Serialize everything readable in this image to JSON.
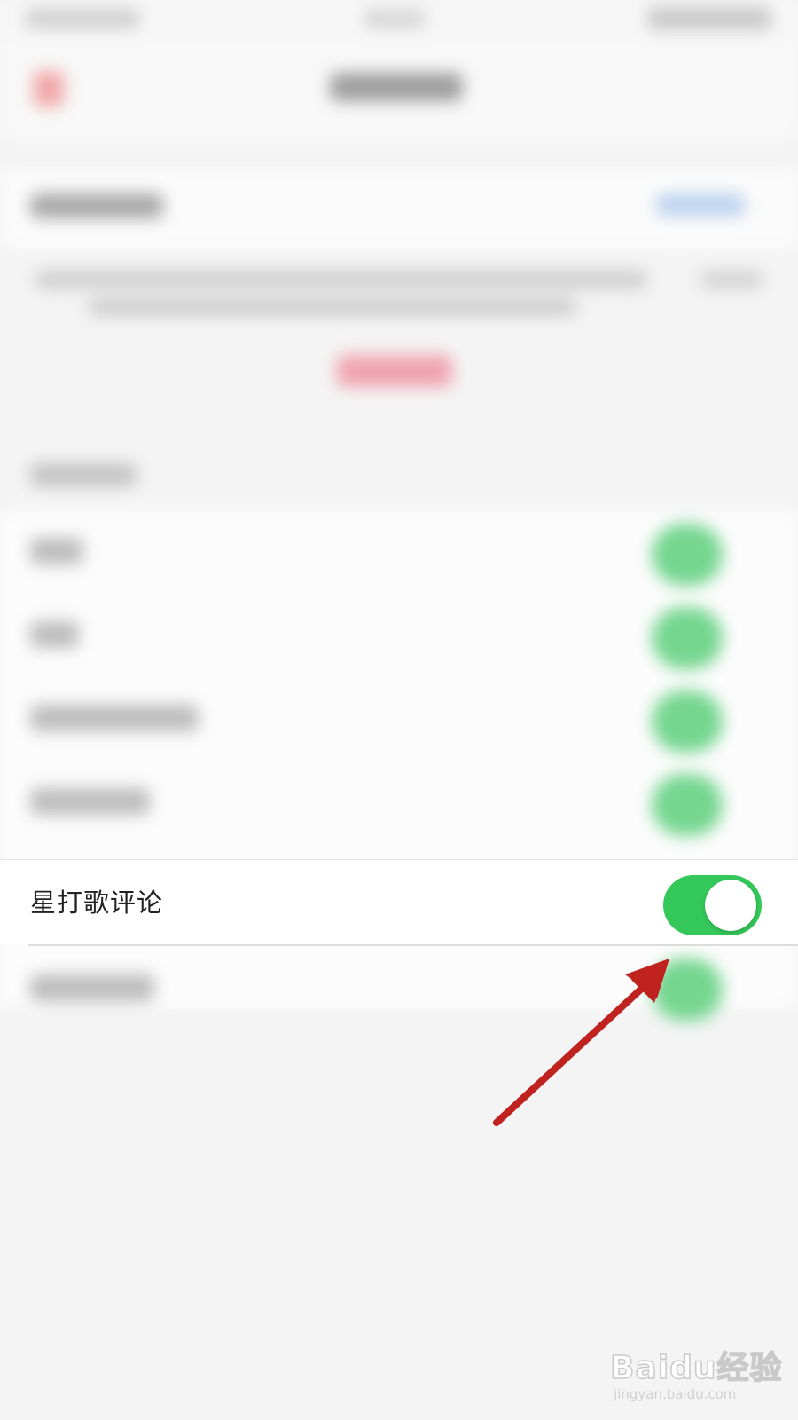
{
  "setting": {
    "label": "星打歌评论",
    "toggle_on": true,
    "toggle_color": "#34c759"
  },
  "annotation": {
    "color": "#c0221f",
    "icon": "arrow-icon"
  },
  "watermark": {
    "logo": "Baidu经验",
    "url": "jingyan.baidu.com"
  }
}
